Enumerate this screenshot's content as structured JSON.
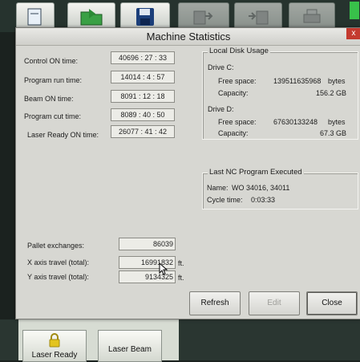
{
  "dialog": {
    "title": "Machine Statistics",
    "close_glyph": "x",
    "close_color": "#c43a2f"
  },
  "timers": [
    {
      "label": "Control ON time:",
      "value": "40696 : 27 : 33"
    },
    {
      "label": "Program run time:",
      "value": "14014 :  4 : 57"
    },
    {
      "label": "Beam ON time:",
      "value": "8091 : 12 : 18"
    },
    {
      "label": "Program cut time:",
      "value": "8089 : 40 : 50"
    },
    {
      "label": "Laser Ready ON time:",
      "value": "26077 : 41 : 42"
    }
  ],
  "disk": {
    "group_title": "Local Disk Usage",
    "drive_c": {
      "label": "Drive C:",
      "free_label": "Free space:",
      "free_value": "139511635968",
      "free_unit": "bytes",
      "cap_label": "Capacity:",
      "cap_value": "156.2 GB"
    },
    "drive_d": {
      "label": "Drive D:",
      "free_label": "Free space:",
      "free_value": "67630133248",
      "free_unit": "bytes",
      "cap_label": "Capacity:",
      "cap_value": "67.3 GB"
    }
  },
  "nc": {
    "group_title": "Last NC Program Executed",
    "name_label": "Name:",
    "name_value": "WO 34016, 34011",
    "cycle_label": "Cycle time:",
    "cycle_value": "0:03:33"
  },
  "counters": [
    {
      "label": "Pallet exchanges:",
      "value": "86039",
      "unit": ""
    },
    {
      "label": "X axis travel (total):",
      "value": "16991832",
      "unit": "ft."
    },
    {
      "label": "Y axis travel (total):",
      "value": "9134325",
      "unit": "ft."
    }
  ],
  "buttons": {
    "refresh": "Refresh",
    "edit": "Edit",
    "close": "Close"
  },
  "background": {
    "laser_ready": "Laser Ready",
    "laser_beam": "Laser Beam"
  }
}
